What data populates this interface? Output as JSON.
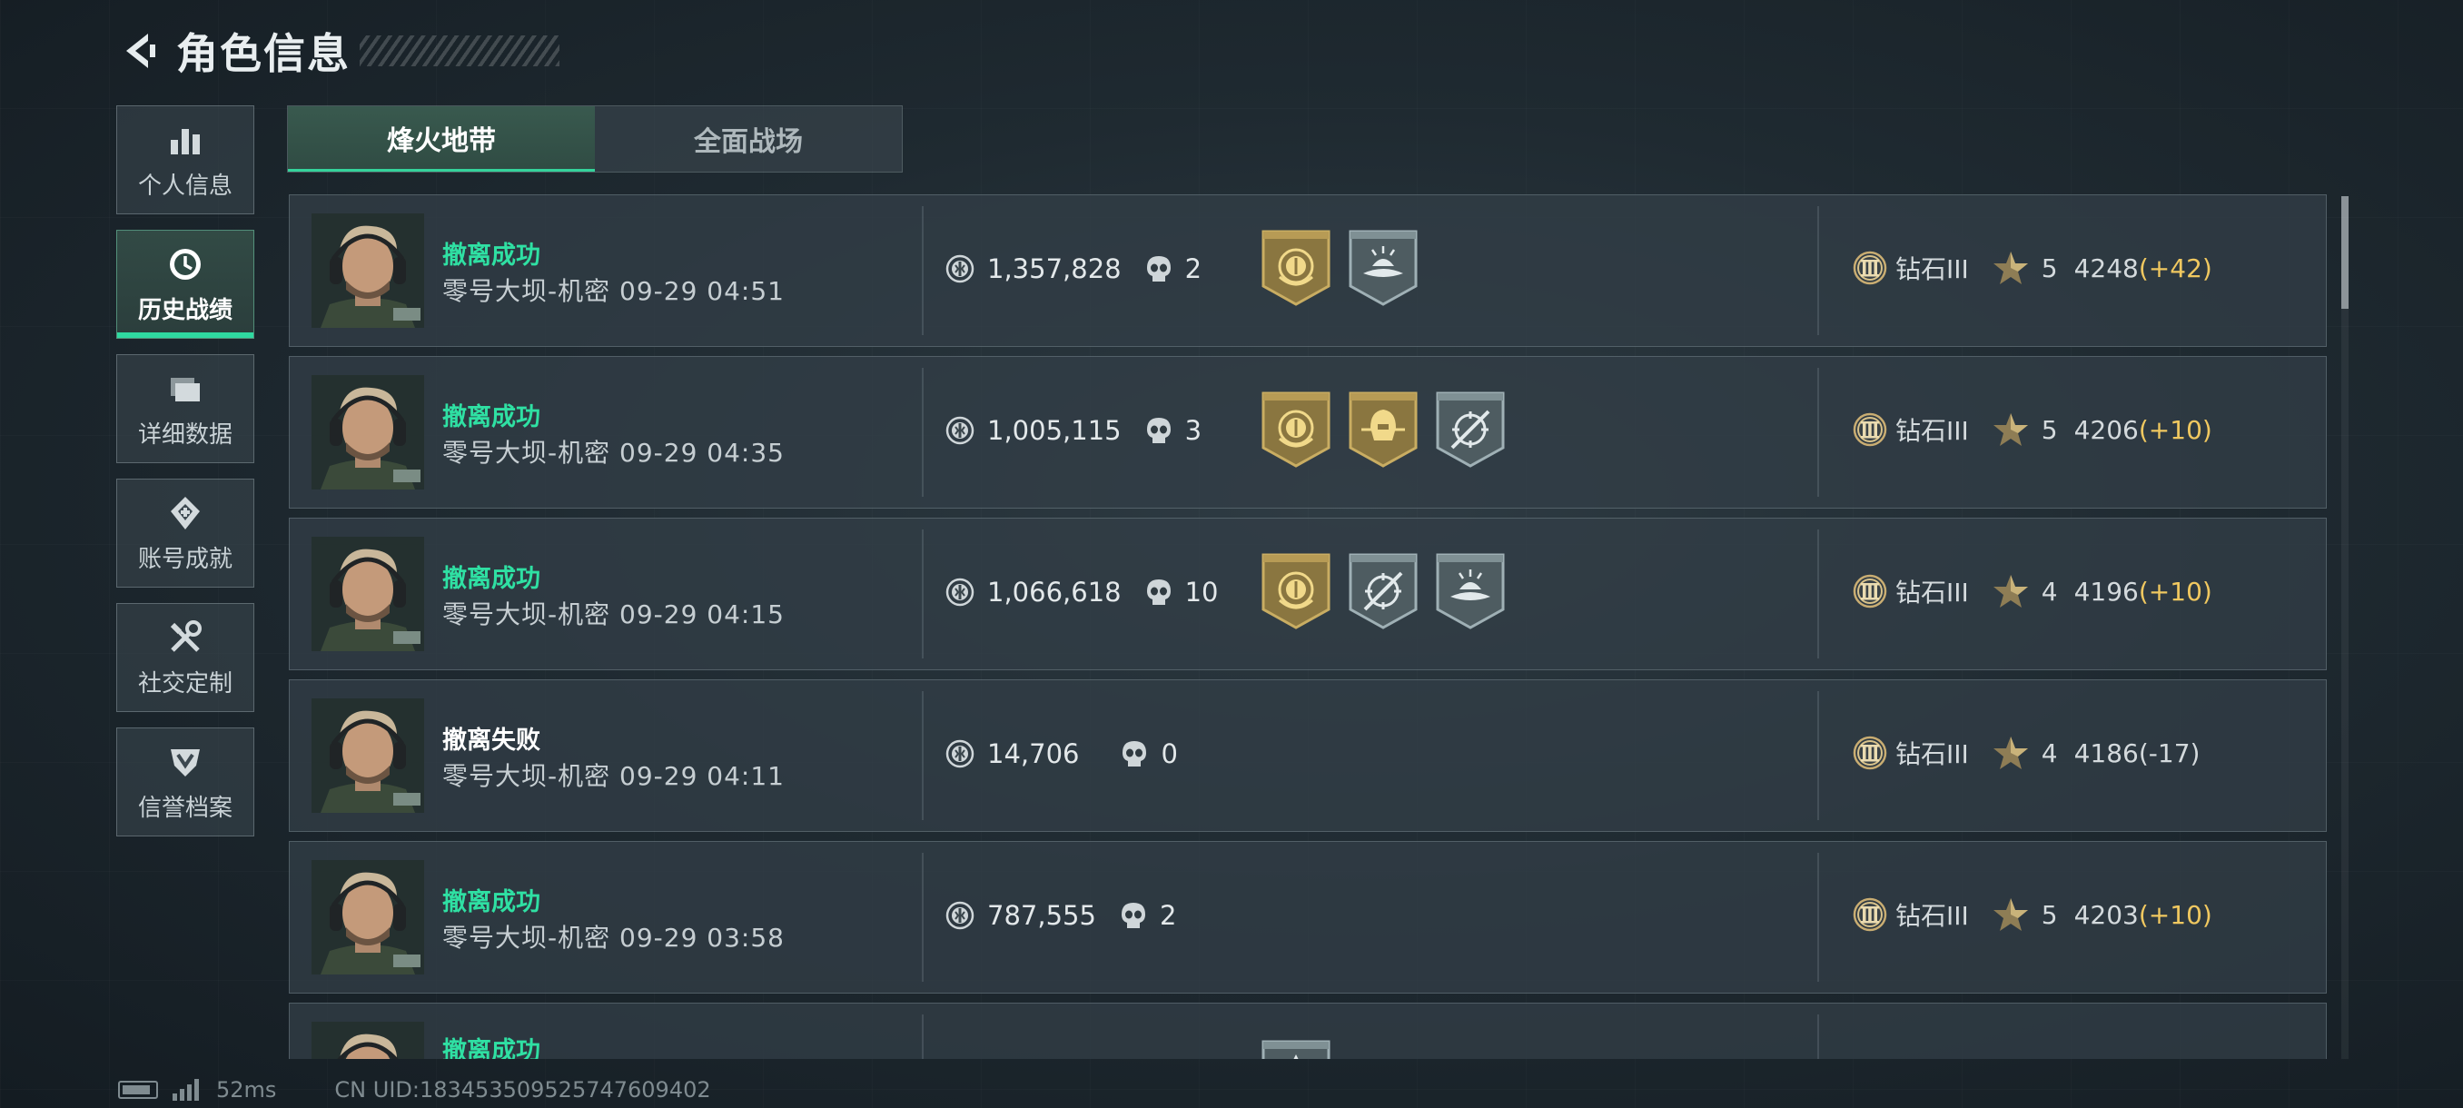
{
  "header": {
    "title": "角色信息"
  },
  "sidebar": {
    "items": [
      {
        "label": "个人信息",
        "icon": "bar-chart-icon"
      },
      {
        "label": "历史战绩",
        "icon": "clock-icon",
        "active": true
      },
      {
        "label": "详细数据",
        "icon": "folders-icon"
      },
      {
        "label": "账号成就",
        "icon": "achievement-icon"
      },
      {
        "label": "社交定制",
        "icon": "tools-icon"
      },
      {
        "label": "信誉档案",
        "icon": "shield-badge-icon"
      }
    ]
  },
  "tabs": [
    {
      "label": "烽火地带",
      "active": true
    },
    {
      "label": "全面战场",
      "active": false
    }
  ],
  "matches": [
    {
      "status": "撤离成功",
      "success": true,
      "map": "零号大坝-机密",
      "time": "09-29 04:51",
      "value": "1,357,828",
      "kills": "2",
      "badges": [
        "gold",
        "silver-wave"
      ],
      "rank": "钻石III",
      "stars": "5",
      "score": "4248",
      "delta": "(+42)"
    },
    {
      "status": "撤离成功",
      "success": true,
      "map": "零号大坝-机密",
      "time": "09-29 04:35",
      "value": "1,005,115",
      "kills": "3",
      "badges": [
        "gold",
        "gold-helmet",
        "silver-target"
      ],
      "rank": "钻石III",
      "stars": "5",
      "score": "4206",
      "delta": "(+10)"
    },
    {
      "status": "撤离成功",
      "success": true,
      "map": "零号大坝-机密",
      "time": "09-29 04:15",
      "value": "1,066,618",
      "kills": "10",
      "badges": [
        "gold",
        "silver-target",
        "silver-wave"
      ],
      "rank": "钻石III",
      "stars": "4",
      "score": "4196",
      "delta": "(+10)"
    },
    {
      "status": "撤离失败",
      "success": false,
      "map": "零号大坝-机密",
      "time": "09-29 04:11",
      "value": "14,706",
      "kills": "0",
      "badges": [],
      "rank": "钻石III",
      "stars": "4",
      "score": "4186",
      "delta": "(-17)"
    },
    {
      "status": "撤离成功",
      "success": true,
      "map": "零号大坝-机密",
      "time": "09-29 03:58",
      "value": "787,555",
      "kills": "2",
      "badges": [],
      "rank": "钻石III",
      "stars": "5",
      "score": "4203",
      "delta": "(+10)"
    },
    {
      "status": "撤离成功",
      "success": true,
      "map": "",
      "time": "",
      "value": "",
      "kills": "",
      "badges": [
        "silver"
      ],
      "rank": "",
      "stars": "",
      "score": "",
      "delta": ""
    }
  ],
  "footer": {
    "ping": "52ms",
    "uid": "CN UID:183453509525747609402"
  },
  "colors": {
    "success": "#2fe0a3",
    "gain": "#f0c860",
    "accent": "#34d39b"
  }
}
